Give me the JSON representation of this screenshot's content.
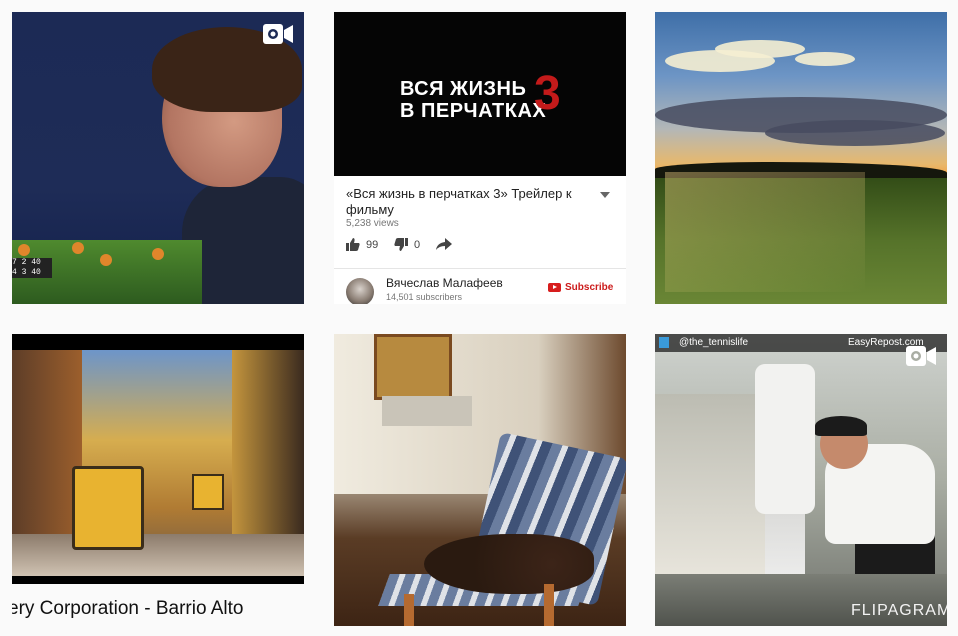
{
  "tiles": {
    "tennis": {
      "score_lines": [
        "7 2 40",
        "4 3 40"
      ]
    },
    "youtube": {
      "video_title_line1": "ВСЯ ЖИЗНЬ",
      "video_title_line2": "В ПЕРЧАТКАХ",
      "video_number": "3",
      "title": "«Вся жизнь в перчатках 3»  Трейлер к фильму",
      "views": "5,238 views",
      "likes": "99",
      "dislikes": "0",
      "channel_name": "Вячеслав Малафеев",
      "subscribers": "14,501 subscribers",
      "subscribe_label": "Subscribe"
    },
    "lisbon": {
      "caption": "ery Corporation - Barrio Alto"
    },
    "flipagram": {
      "handle": "@the_tennislife",
      "repost": "EasyRepost.com",
      "watermark": "FLIPAGRAM"
    }
  },
  "colors": {
    "background": "#fafafa",
    "youtube_red": "#cc1b1b"
  }
}
